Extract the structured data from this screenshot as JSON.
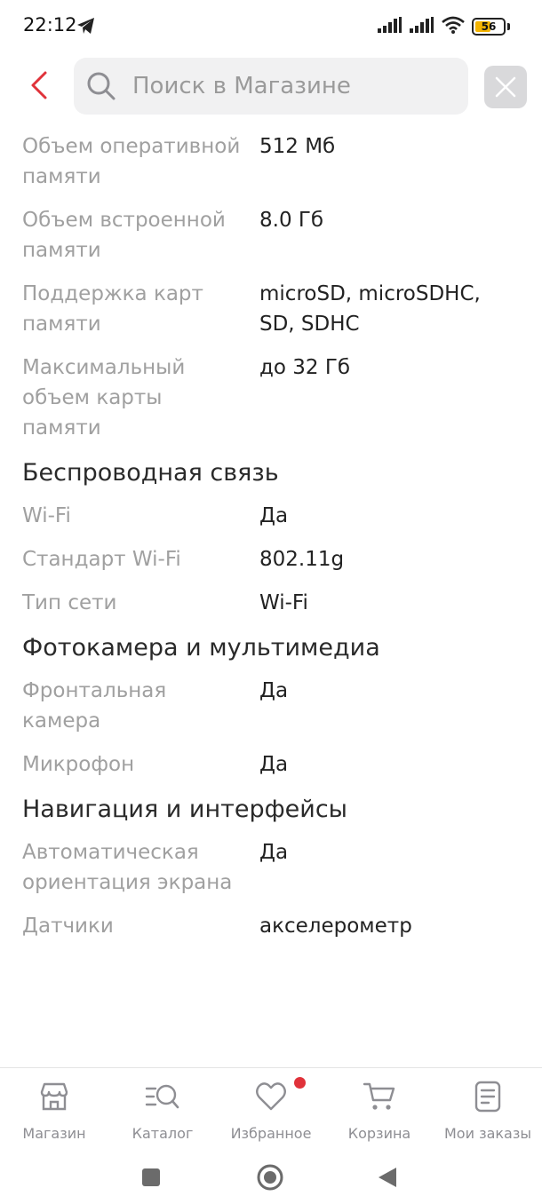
{
  "status_bar": {
    "time": "22:12",
    "battery_level": "56",
    "battery_fraction": 0.56
  },
  "header": {
    "search_placeholder": "Поиск в Магазине"
  },
  "specs": {
    "memory_rows": [
      {
        "label": "Объем оперативной памяти",
        "value": "512 Мб"
      },
      {
        "label": "Объем встроенной памяти",
        "value": "8.0 Гб"
      },
      {
        "label": "Поддержка карт памяти",
        "value": "microSD, microSDHC, SD, SDHC"
      },
      {
        "label": "Максимальный объем карты памяти",
        "value": "до 32 Гб"
      }
    ],
    "wireless_title": "Беспроводная связь",
    "wireless_rows": [
      {
        "label": "Wi-Fi",
        "value": "Да"
      },
      {
        "label": "Стандарт Wi-Fi",
        "value": "802.11g"
      },
      {
        "label": "Тип сети",
        "value": "Wi-Fi"
      }
    ],
    "camera_title": "Фотокамера и мультимедиа",
    "camera_rows": [
      {
        "label": "Фронтальная камера",
        "value": "Да"
      },
      {
        "label": "Микрофон",
        "value": "Да"
      }
    ],
    "navigation_title": "Навигация и интерфейсы",
    "navigation_rows": [
      {
        "label": "Автоматическая ориентация экрана",
        "value": "Да"
      },
      {
        "label": "Датчики",
        "value": "акселерометр"
      }
    ]
  },
  "bottom_nav": {
    "items": [
      {
        "label": "Магазин",
        "icon": "store-icon"
      },
      {
        "label": "Каталог",
        "icon": "catalog-search-icon"
      },
      {
        "label": "Избранное",
        "icon": "heart-icon",
        "badge": true
      },
      {
        "label": "Корзина",
        "icon": "cart-icon"
      },
      {
        "label": "Мои заказы",
        "icon": "orders-icon"
      }
    ]
  },
  "colors": {
    "accent": "#e0323a",
    "label_gray": "#a0a0a0",
    "icon_gray": "#8e8e93",
    "battery": "#f4b400"
  }
}
